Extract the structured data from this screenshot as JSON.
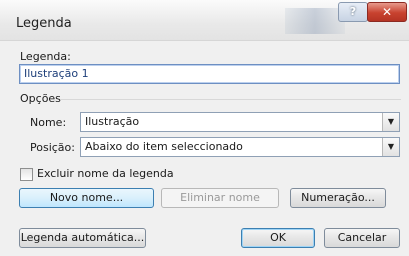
{
  "window": {
    "title": "Legenda",
    "help_glyph": "?",
    "close_glyph": "✕"
  },
  "legend": {
    "label": "Legenda:",
    "value": "Ilustração 1"
  },
  "options": {
    "group_label": "Opções",
    "name_label": "Nome:",
    "name_value": "Ilustração",
    "position_label": "Posição:",
    "position_value": "Abaixo do item seleccionado"
  },
  "exclude_label": {
    "text": "Excluir nome da legenda",
    "checked": false
  },
  "buttons": {
    "new_name": "Novo nome...",
    "delete_name": "Eliminar nome",
    "numbering": "Numeração...",
    "auto_caption": "Legenda automática...",
    "ok": "OK",
    "cancel": "Cancelar"
  },
  "icons": {
    "dropdown": "chevron-down-icon"
  }
}
